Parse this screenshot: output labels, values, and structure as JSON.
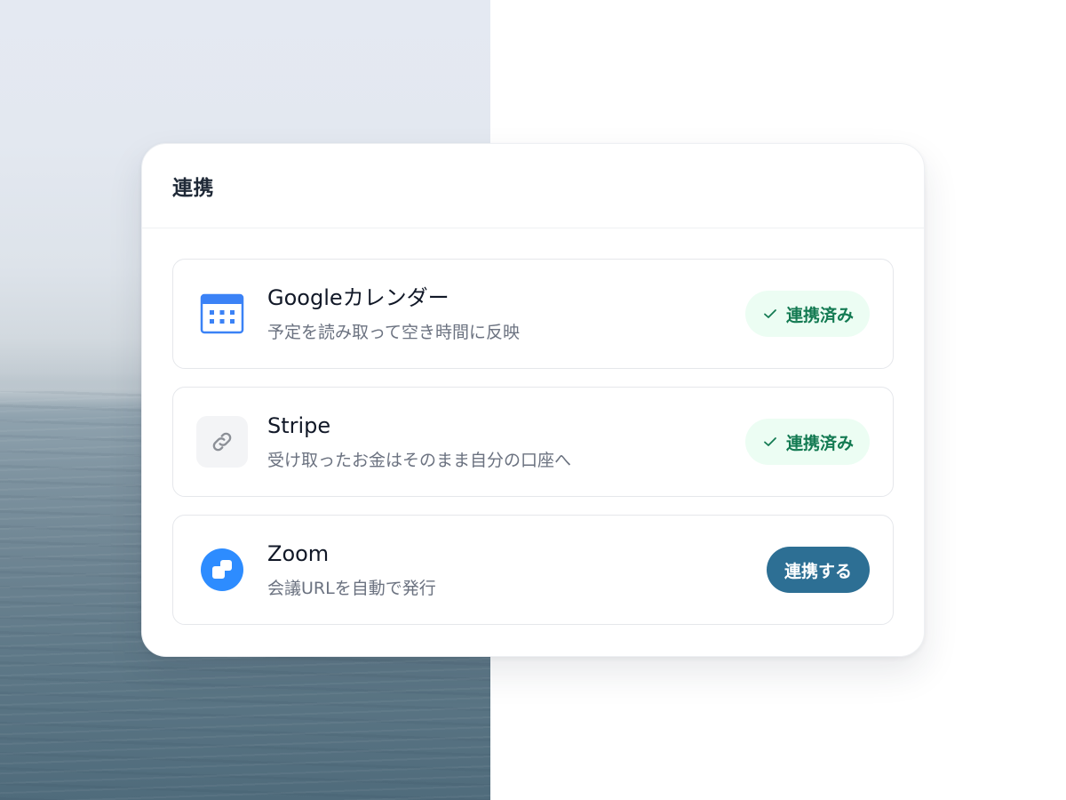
{
  "card": {
    "title": "連携"
  },
  "integrations": [
    {
      "name": "Googleカレンダー",
      "description": "予定を読み取って空き時間に反映",
      "status": "連携済み",
      "icon": "calendar-icon"
    },
    {
      "name": "Stripe",
      "description": "受け取ったお金はそのまま自分の口座へ",
      "status": "連携済み",
      "icon": "link-icon"
    },
    {
      "name": "Zoom",
      "description": "会議URLを自動で発行",
      "action": "連携する",
      "icon": "zoom-icon"
    }
  ],
  "colors": {
    "connected_badge_bg": "#ecfdf3",
    "connected_badge_text": "#137a52",
    "connect_button_bg": "#2d6f94",
    "calendar_blue": "#3b82f6",
    "zoom_blue": "#2d8cff"
  }
}
